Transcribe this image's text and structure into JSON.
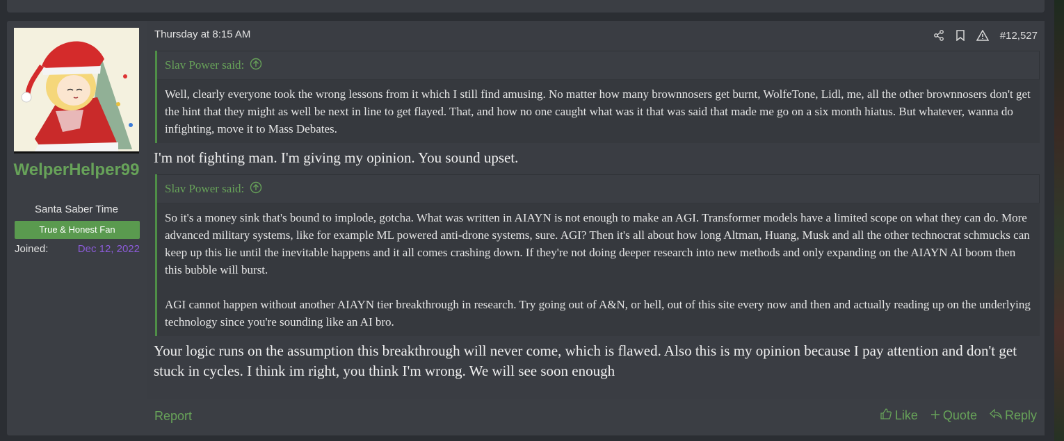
{
  "user": {
    "name": "WelperHelper99",
    "title": "Santa Saber Time",
    "banner": "True & Honest Fan",
    "joined_label": "Joined:",
    "joined_date": "Dec 12, 2022"
  },
  "post": {
    "date": "Thursday at 8:15 AM",
    "number": "#12,527",
    "icons": [
      "share-icon",
      "bookmark-icon",
      "warning-icon"
    ]
  },
  "quotes": [
    {
      "author": "Slav Power said:",
      "paragraphs": [
        "Well, clearly everyone took the wrong lessons from it which I still find amusing. No matter how many brownnosers get burnt, WolfeTone, Lidl, me, all the other brownnosers don't get the hint that they might as well be next in line to get flayed. That, and how no one caught what was it that was said that made me go on a six month hiatus. But whatever, wanna do infighting, move it to Mass Debates."
      ]
    },
    {
      "author": "Slav Power said:",
      "paragraphs": [
        "So it's a money sink that's bound to implode, gotcha. What was written in AIAYN is not enough to make an AGI. Transformer models have a limited scope on what they can do. More advanced military systems, like for example ML powered anti-drone systems, sure. AGI? Then it's all about how long Altman, Huang, Musk and all the other technocrat schmucks can keep up this lie until the inevitable happens and it all comes crashing down. If they're not doing deeper research into new methods and only expanding on the AIAYN AI boom then this bubble will burst.",
        "AGI cannot happen without another AIAYN tier breakthrough in research. Try going out of A&N, or hell, out of this site every now and then and actually reading up on the underlying technology since you're sounding like an AI bro."
      ]
    }
  ],
  "replies": [
    "I'm not fighting man. I'm giving my opinion. You sound upset.",
    "Your logic runs on the assumption this breakthrough will never come, which is flawed. Also this is my opinion because I pay attention and don't get stuck in cycles. I think im right, you think I'm wrong. We will see soon enough"
  ],
  "footer": {
    "report": "Report",
    "like": "Like",
    "quote": "Quote",
    "reply": "Reply"
  },
  "colors": {
    "accent_green": "#67a259",
    "banner_green": "#5a9a4f",
    "joined_date_purple": "#8b5bd8",
    "panel_bg": "#3b3e44",
    "page_bg": "#2b2e33"
  }
}
